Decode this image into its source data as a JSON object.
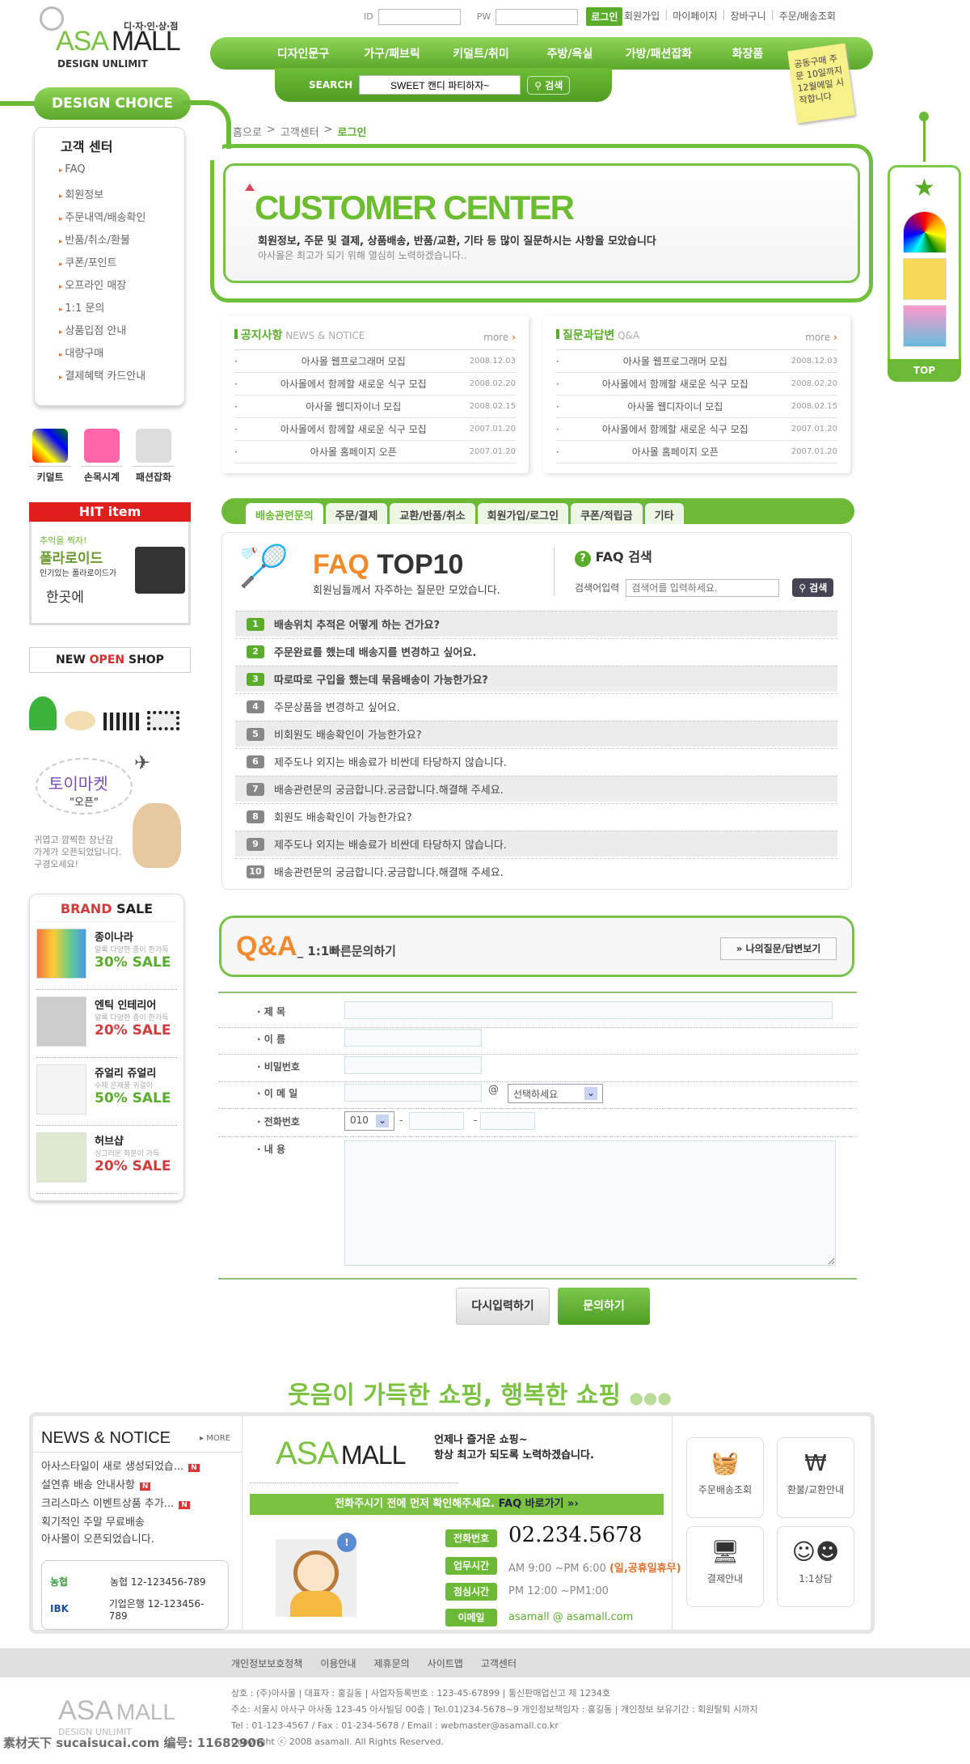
{
  "colors": {
    "brand_green": "#6cb935",
    "accent_red": "#d62b2b",
    "accent_orange": "#e0702a"
  },
  "header": {
    "logo": {
      "tagline_kr": "디·자·인·상·점",
      "asa": "ASA",
      "mall": "MALL",
      "sub": "DESIGN UNLIMIT"
    },
    "login": {
      "id_label": "ID",
      "pw_label": "PW",
      "id_value": "",
      "pw_value": "",
      "login_button": "로그인"
    },
    "top_links": [
      "회원가입",
      "마이페이지",
      "장바구니",
      "주문/배송조회"
    ],
    "nav": [
      "디자인문구",
      "가구/패브릭",
      "키덜트/취미",
      "주방/욕실",
      "가방/패션잡화",
      "화장품"
    ],
    "search": {
      "label": "SEARCH",
      "value": "SWEET 캔디 파티하자~",
      "button": "검색"
    },
    "sticky_note": "공동구매 주문 10일까지 12월에일 시작합니다"
  },
  "sidebar": {
    "section_pill": "DESIGN CHOICE",
    "title": "고객 센터",
    "items": [
      "FAQ",
      "회원정보",
      "주문내역/배송확인",
      "반품/취소/환불",
      "쿠폰/포인트",
      "오프라인 매장",
      "1:1 문의",
      "상품입점 안내",
      "대량구매",
      "결제혜택 카드안내"
    ],
    "categories": [
      "키덜트",
      "손목시계",
      "패션잡화"
    ],
    "hit": {
      "title": "HIT item",
      "line1": "추억을 찍자!",
      "line2": "폴라로이드",
      "line3": "인기있는 폴라로이드가",
      "line4": "한곳에"
    },
    "new_open": {
      "a": "NEW ",
      "b": "OPEN",
      "c": " SHOP"
    },
    "toy": {
      "title": "토이마켓",
      "sub": "\"오픈\"",
      "desc1": "귀엽고 깜찍한 장난감",
      "desc2": "가게가 오픈되었답니다.",
      "desc3": "구경오세요!"
    },
    "brand_sale": {
      "title_a": "BRAND",
      "title_b": " SALE",
      "items": [
        {
          "name": "종이나라",
          "desc": "알록 다양한 종이 한가득",
          "sale": "30% SALE",
          "color": "#5aad2b"
        },
        {
          "name": "엔틱 인테리어",
          "desc": "알록 다양한 종이 한가득",
          "sale": "20% SALE",
          "color": "#d23b3b"
        },
        {
          "name": "쥬얼리 쥬얼리",
          "desc": "수제 은제품 귀걸이",
          "sale": "50% SALE",
          "color": "#5aad2b"
        },
        {
          "name": "허브샵",
          "desc": "싱그러운 화분이 가득",
          "sale": "20% SALE",
          "color": "#d23b3b"
        }
      ]
    }
  },
  "breadcrumb": {
    "home": "홈으로",
    "mid": "고객센터",
    "current": "로그인",
    "sep": ">"
  },
  "customer_center": {
    "title": "CUSTOMER CENTER",
    "desc": "회원정보, 주문 및 결제, 상품배송, 반품/교환, 기타 등 많이 질문하시는 사항을 모았습니다",
    "sub": "아사몰은 최고가 되기 위해 열심히 노력하겠습니다.."
  },
  "notice": {
    "title_kr": "공지사항",
    "title_en": "NEWS & NOTICE",
    "more": "more",
    "rows": [
      {
        "t": "아사몰 웹프로그래머 모집",
        "d": "2008.12.03"
      },
      {
        "t": "아사몰에서 함께할 새로운 식구 모집",
        "d": "2008.02.20"
      },
      {
        "t": "아사몰 웹디자이너 모집",
        "d": "2008.02.15"
      },
      {
        "t": "아사몰에서 함께할 새로운 식구 모집",
        "d": "2007.01.20"
      },
      {
        "t": "아사몰 홈페이지 오픈",
        "d": "2007.01.20"
      }
    ]
  },
  "qna_list": {
    "title_kr": "질문과답변",
    "title_en": "Q&A",
    "more": "more",
    "rows": [
      {
        "t": "아사몰 웹프로그래머 모집",
        "d": "2008.12.03"
      },
      {
        "t": "아사몰에서 함께할 새로운 식구 모집",
        "d": "2008.02.20"
      },
      {
        "t": "아사몰 웹디자이너 모집",
        "d": "2008.02.15"
      },
      {
        "t": "아사몰에서 함께할 새로운 식구 모집",
        "d": "2007.01.20"
      },
      {
        "t": "아사몰 홈페이지 오픈",
        "d": "2007.01.20"
      }
    ]
  },
  "faq": {
    "tabs": [
      "배송관련문의",
      "주문/결제",
      "교환/반품/취소",
      "회원가입/로그인",
      "쿠폰/적립금",
      "기타"
    ],
    "active_tab": 0,
    "title_a": "FAQ",
    "title_b": "TOP10",
    "subtitle": "회원님들께서 자주하는 질문만 모았습니다.",
    "search_title": "FAQ 검색",
    "search_label": "검색어입력",
    "search_placeholder": "검색어를 입력하세요.",
    "search_button": "검색",
    "items": [
      "배송위치 추적은 어떻게 하는 건가요?",
      "주문완료를 했는데 배송지를 변경하고 싶어요.",
      "따로따로 구입을 했는데 묶음배송이 가능한가요?",
      "주문상품을 변경하고 싶어요.",
      "비회원도 배송확인이 가능한가요?",
      "제주도나 외지는 배송료가 비싼데 타당하지 않습니다.",
      "배송관련문의 궁금합니다.궁금합니다.해결해 주세요.",
      "회원도 배송확인이 가능한가요?",
      "제주도나 외지는 배송료가 비싼데 타당하지 않습니다.",
      "배송관련문의 궁금합니다.궁금합니다.해결해 주세요."
    ]
  },
  "qa_form": {
    "title": "Q&A",
    "subtitle": "_ 1:1빠른문의하기",
    "my_button": "» 나의질문/답변보기",
    "labels": {
      "subject": "· 제    목",
      "name": "· 이    름",
      "password": "· 비밀번호",
      "email": "· 이 메 일",
      "phone": "· 전화번호",
      "content": "· 내    용"
    },
    "at": "@",
    "email_domain_select": "선택하세요",
    "phone_prefix": "010",
    "dash": "-",
    "reset_button": "다시입력하기",
    "submit_button": "문의하기"
  },
  "slogan": {
    "text": "웃음이 가득한 쇼핑, 행복한 쇼핑"
  },
  "footer_box": {
    "news_title": "NEWS & NOTICE",
    "more": "▸ MORE",
    "news": [
      {
        "t": "아사스타일이 새로 생성되었습...",
        "new": true
      },
      {
        "t": "설연휴 배송 안내사항",
        "new": true
      },
      {
        "t": "크리스마스 이벤트상품 추가...",
        "new": true
      },
      {
        "t": "획기적인 주말 무료배송",
        "new": false
      },
      {
        "t": "아사몰이 오픈되었습니다.",
        "new": false
      }
    ],
    "new_badge": "N",
    "banks": [
      {
        "logo": "농협",
        "text": "농협 12-123456-789"
      },
      {
        "logo": "IBK",
        "text": "기업은행 12-123456-789"
      }
    ],
    "brand_asa": "ASA",
    "brand_mall": "MALL",
    "brand_msg1": "언제나 즐거운 쇼핑~",
    "brand_msg2": "항상 최고가 되도록 노력하겠습니다.",
    "faq_banner": "전화주시기 전에 먼저 확인해주세요.",
    "faq_link": "FAQ 바로가기 »›",
    "contact": {
      "phone_label": "전화번호",
      "phone": "02.234.5678",
      "hours_label": "업무시간",
      "hours": "AM 9:00 ~PM 6:00",
      "hours_note": "(일,공휴일휴무)",
      "lunch_label": "점심시간",
      "lunch": "PM 12:00 ~PM1:00",
      "email_label": "이메일",
      "email": "asamall @ asamall.com"
    },
    "quick": [
      {
        "label": "주문배송조회",
        "icon": "basket-icon"
      },
      {
        "label": "환불/교환안내",
        "icon": "won-bubble-icon"
      },
      {
        "label": "결제안내",
        "icon": "monitor-search-icon"
      },
      {
        "label": "1:1상담",
        "icon": "faces-icon"
      }
    ]
  },
  "right_float": {
    "top": "TOP"
  },
  "footer": {
    "links": [
      "개인정보보호정책",
      "이용안내",
      "제휴문의",
      "사이트맵",
      "고객센터"
    ],
    "lines": [
      "상호 : (주)아사몰  |  대표자 : 홍길동  |  사업자등록번호 : 123-45-67899  |  통신판매업신고 제 1234호",
      "주소: 서울시 아사구 아사동 123-45 아사빌딩 00층 | Tel.01)234-5678~9 개인정보책임자 : 홍길동 | 개인정보 보유기간 : 회원탈퇴 시까지",
      "Tel : 01-123-4567  /  Fax : 01-234-5678   /   Email : webmaster@asamall.co.kr",
      "Copyright ⓒ 2008 asamall.  All Rights Reserved."
    ],
    "logo_asa": "ASA",
    "logo_mall": "MALL",
    "logo_sub": "DESIGN UNLIMIT",
    "watermark": "素材天下 sucaisucai.com  编号: 11682906"
  }
}
